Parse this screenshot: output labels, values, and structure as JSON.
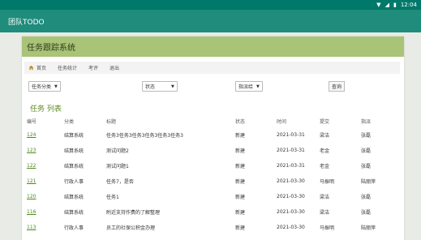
{
  "status_bar": {
    "time": "12:04"
  },
  "app": {
    "title": "团队TODO"
  },
  "card": {
    "header": "任务跟踪系统"
  },
  "nav": [
    {
      "label": "首页",
      "icon": "home-icon"
    },
    {
      "label": "任务统计"
    },
    {
      "label": "考评"
    },
    {
      "label": "退出"
    }
  ],
  "filters": {
    "category": "任务分类",
    "status": "状态",
    "tracker": "指派给",
    "query": "查询"
  },
  "list": {
    "title": "任务 列表",
    "columns": [
      "编号",
      "分类",
      "标题",
      "状态",
      "时间",
      "提交",
      "指派"
    ],
    "rows": [
      [
        "124",
        "结算系统",
        "任务3任务3任务3任务3任务3任务3",
        "新建",
        "2021-03-31",
        "梁洁",
        "张磊"
      ],
      [
        "123",
        "结算系统",
        "测试问题2",
        "新建",
        "2021-03-31",
        "老金",
        "张磊"
      ],
      [
        "122",
        "结算系统",
        "测试问题1",
        "新建",
        "2021-03-31",
        "老金",
        "张磊"
      ],
      [
        "121",
        "行政人事",
        "任务7，是否",
        "新建",
        "2021-03-30",
        "马振明",
        "陆丽萍"
      ],
      [
        "120",
        "结算系统",
        "任务1",
        "新建",
        "2021-03-30",
        "梁洁",
        "张磊"
      ],
      [
        "116",
        "结算系统",
        "附近支持作费的了解整理",
        "新建",
        "2021-03-30",
        "梁洁",
        "张磊"
      ],
      [
        "113",
        "行政人事",
        "员工的社保公积金办理",
        "新建",
        "2021-03-30",
        "马振明",
        "陆丽萍"
      ]
    ]
  }
}
